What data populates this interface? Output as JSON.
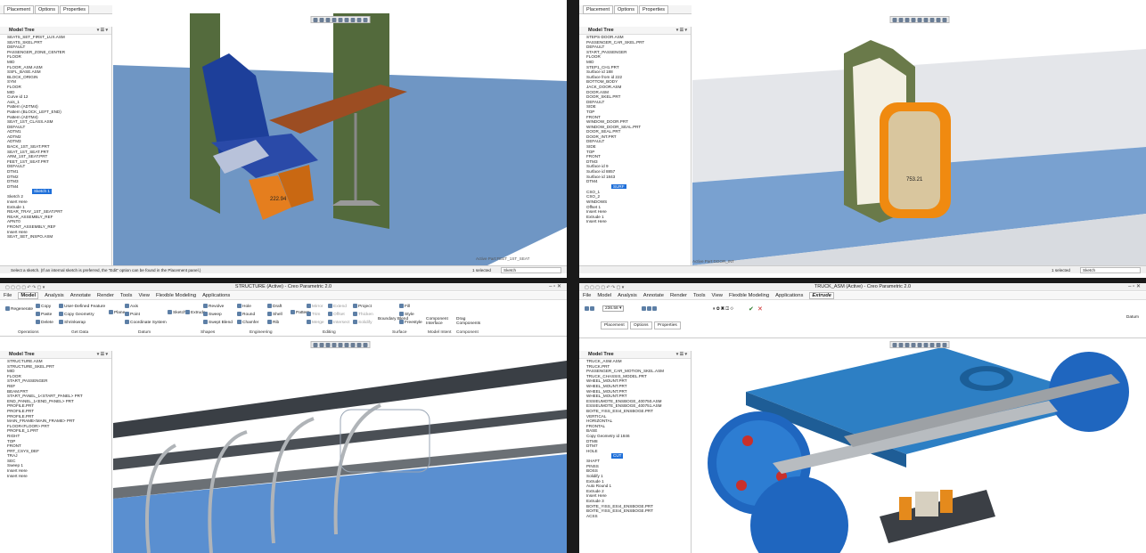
{
  "q1": {
    "dashboard_tabs": [
      "Placement",
      "Options",
      "Properties"
    ],
    "tree_title": "Model Tree",
    "tree": [
      "SEATS_SET_FIRST_LUX.ASM",
      "SEATS_SKEL.PRT",
      "DEFAULT",
      "PASSENGER_ZONE_CENTER",
      "FLOOR",
      "MID",
      "FLOOR_ASM.ASM",
      "SSFL_BASE.ASM",
      "BLOCK_ORIGIN",
      "SYM",
      "FLOOR",
      "MID",
      "Curve id 12",
      "Axis_1",
      "Pattern (ADTM4)",
      "Pattern (BLOCK_LEFT_END)",
      "Pattern (ADTM4)",
      "SEAT_1ST_CLASS.ASM",
      "DEFAULT",
      "ADTM1",
      "ADTM2",
      "ADTM3",
      "BACK_1ST_SEAT.PRT",
      "SEAT_1ST_SEAT.PRT",
      "ARM_1ST_SEAT.PRT",
      "FEET_1ST_SEAT.PRT",
      "DEFAULT",
      "DTM1",
      "DTM2",
      "DTM3",
      "DTM4",
      "Sketch 1",
      "Sketch 2",
      "Insert Here",
      "Extrude 1",
      "REAR_TRAY_1ST_SEAT.PRT",
      "REAR_ASSEMBLY_REF",
      "APNT0",
      "FRONT_ASSEMBLY_REF",
      "Insert Here",
      "SEAT_SET_INSPO.ASM"
    ],
    "selected_index": 31,
    "status_msg": "Select a sketch. (If an internal sketch is preferred, the \"Edit\" option can be found in the Placement panel.)",
    "active_part": "Active Part:FEET_1ST_SEAT",
    "dim_label": "222.94",
    "selected_count": "1 selected",
    "filter": "Sketch"
  },
  "q2": {
    "dashboard_tabs": [
      "Placement",
      "Options",
      "Properties"
    ],
    "tree_title": "Model Tree",
    "tree": [
      "STEPS-DOOR.ASM",
      "PASSENGER_CAR_SKEL.PRT",
      "DEFAULT",
      "START_PASSENGER",
      "FLOOR",
      "MID",
      "STEP1_CH1.PRT",
      "Surface id 188",
      "Surface from id 222",
      "BOTTOM_BODY",
      "JACK_DOOR.ASM",
      "DOOR.ASM",
      "DOOR_SKEL.PRT",
      "DEFAULT",
      "SIDE",
      "TOP",
      "FRONT",
      "WINDOW_DOOR.PRT",
      "WINDOW_DOOR_SEAL.PRT",
      "DOOR_SEAL.PRT",
      "DOOR_INT.PRT",
      "DEFAULT",
      "SIDE",
      "TOP",
      "FRONT",
      "DTM3",
      "Surface id 9",
      "Surface id 8857",
      "Surface id 1843",
      "DTM4",
      "SURF",
      "CSO_1",
      "CSO_2",
      "WINDOWS",
      "Offset 1",
      "Insert Here",
      "Extrude 1",
      "Insert Here"
    ],
    "selected_index": 30,
    "active_part": "Active Part:DOOR_INT",
    "dim_label": "753.21",
    "selected_count": "1 selected",
    "filter": "Sketch"
  },
  "q3": {
    "window_title": "STRUCTURE (Active) - Creo Parametric 2.0",
    "menu": [
      "File",
      "Model",
      "Analysis",
      "Annotate",
      "Render",
      "Tools",
      "View",
      "Flexible Modeling",
      "Applications"
    ],
    "active_menu": "Model",
    "ribbon_items": [
      "Copy",
      "User-Defined Feature",
      "Paste",
      "Copy Geometry",
      "Delete",
      "Shrinkwrap",
      "Axis",
      "Point",
      "Coordinate System",
      "Revolve",
      "Sweep",
      "Swept Blend",
      "Hole",
      "Round",
      "Chamfer",
      "Draft",
      "Shell",
      "Rib",
      "Mirror",
      "Trim",
      "Merge",
      "Extend",
      "Offset",
      "Intersect",
      "Project",
      "Thicken",
      "Solidify",
      "Fill",
      "Style",
      "Freestyle"
    ],
    "big_buttons": [
      "Regenerate",
      "Plane",
      "Sketch",
      "Extrude",
      "Pattern",
      "Boundary Blend",
      "Component Interface",
      "Drag Components"
    ],
    "groups": [
      "Operations",
      "Get Data",
      "Datum",
      "Shapes",
      "Engineering",
      "Editing",
      "Surface",
      "Model Intent",
      "Component"
    ],
    "tree_title": "Model Tree",
    "tree": [
      "STRUCTURE.ASM",
      "STRUCTURE_SKEL.PRT",
      "MID",
      "FLOOR",
      "START_PASSENGER",
      "REF",
      "BEAM.PRT",
      "START_PANEL_1<START_PANEL> PRT",
      "END_PANEL_1<END_PANEL> PRT",
      "PROFILE.PRT",
      "PROFILE.PRT",
      "PROFILE.PRT",
      "MAIN_FRAME<MAIN_FRAME> PRT",
      "FLOOR<FLOOR> PRT",
      "PROFILE_1.PRT",
      "RIGHT",
      "TOP",
      "FRONT",
      "PRT_CSYS_DEF",
      "TRAJ",
      "SEC",
      "Sweep 1",
      "Insert Here",
      "Insert Here"
    ]
  },
  "q4": {
    "window_title": "TRUCK_ASM (Active) - Creo Parametric 2.0",
    "menu": [
      "File",
      "Model",
      "Analysis",
      "Annotate",
      "Render",
      "Tools",
      "View",
      "Flexible Modeling",
      "Applications"
    ],
    "active_menu": "Extrude",
    "depth_value": "236.58",
    "dashboard_tabs": [
      "Placement",
      "Options",
      "Properties"
    ],
    "datum_label": "Datum",
    "tree_title": "Model Tree",
    "tree": [
      "TRUCK_ASM.ASM",
      "TRUCK.PRT",
      "PASSENGER_CAR_MOTION_SKEL.ASM",
      "TRUCK_CHASSIS_MODEL.PRT",
      "WHEEL_MOUNT.PRT",
      "WHEEL_MOUNT.PRT",
      "WHEEL_MOUNT.PRT",
      "WHEEL_MOUNT.PRT",
      "ESSIEUMOTE_ENSBOGE_400750.ASM",
      "ESSIEUMOTE_ENSBOGE_400751.ASM",
      "BOITE_YISS_ESI4_ENSBOGE.PRT",
      "VERTICAL",
      "HORIZONTAL",
      "FRONTAL",
      "BASE",
      "Copy Geometry id 1846",
      "DTM8",
      "DTM7",
      "HOLE",
      "CUT",
      "SHAFT",
      "PINSS",
      "BOSS",
      "Solidify 1",
      "Extrude 1",
      "Auto Round 1",
      "Extrude 2",
      "Insert Here",
      "Extrude 3",
      "BOITE_YISS_ESI4_ENSBOGE.PRT",
      "BOITE_YISS_ESI4_ENSBOGE.PRT",
      "ACSS"
    ],
    "selected_index": 19
  }
}
